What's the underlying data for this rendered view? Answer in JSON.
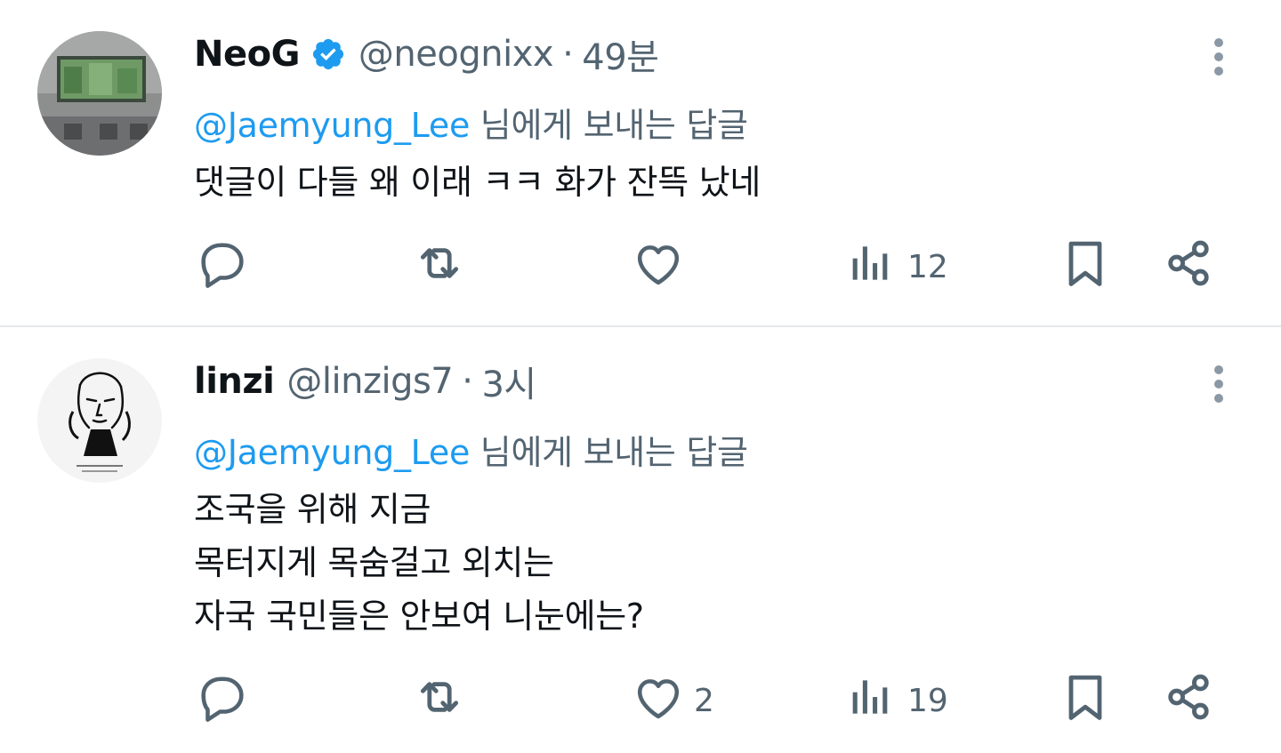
{
  "tweets": [
    {
      "name": "NeoG",
      "verified": true,
      "handle": "@neognixx",
      "separator": "·",
      "time": "49분",
      "reply_mention": "@Jaemyung_Lee",
      "reply_suffix": " 님에게 보내는 답글",
      "text": "댓글이 다들 왜 이래 ㅋㅋ 화가 잔뜩 났네",
      "actions": {
        "reply": "",
        "retweet": "",
        "like": "",
        "views": "12"
      }
    },
    {
      "name": "linzi",
      "verified": false,
      "handle": "@linzigs7",
      "separator": "·",
      "time": "3시",
      "reply_mention": "@Jaemyung_Lee",
      "reply_suffix": " 님에게 보내는 답글",
      "text": "조국을 위해 지금\n목터지게 목숨걸고 외치는\n자국 국민들은 안보여 니눈에는?",
      "actions": {
        "reply": "",
        "retweet": "",
        "like": "2",
        "views": "19"
      }
    }
  ],
  "icons": [
    "more-icon",
    "verified-icon",
    "reply-icon",
    "retweet-icon",
    "like-icon",
    "views-icon",
    "bookmark-icon",
    "share-icon"
  ],
  "colors": {
    "accent": "#1d9bf0",
    "secondary_text": "#536471",
    "divider": "#e6e9eb"
  }
}
